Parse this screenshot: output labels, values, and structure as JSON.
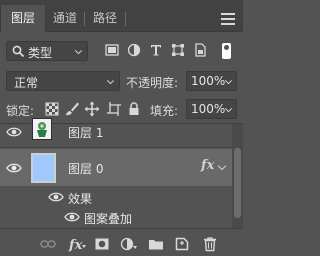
{
  "tabs": [
    {
      "label": "图层",
      "active": true
    },
    {
      "label": "通道",
      "active": false
    },
    {
      "label": "路径",
      "active": false
    }
  ],
  "filter": {
    "kind_label": "类型",
    "icons": [
      "image-filter-icon",
      "adjustment-filter-icon",
      "type-filter-icon",
      "shape-filter-icon",
      "smart-object-filter-icon"
    ]
  },
  "blend": {
    "mode": "正常",
    "opacity_label": "不透明度:",
    "opacity_value": "100%"
  },
  "lock": {
    "label": "锁定:",
    "fill_label": "填充:",
    "fill_value": "100%"
  },
  "layers": [
    {
      "name": "图层 1",
      "visible": true,
      "has_fx": false
    },
    {
      "name": "图层 0",
      "visible": true,
      "has_fx": true,
      "selected": true,
      "fx_label": "fx"
    }
  ],
  "effects": {
    "header": "效果",
    "items": [
      "图案叠加"
    ]
  },
  "colors": {
    "panel_bg": "#535353",
    "tab_bg": "#424242",
    "selected_row": "#696969",
    "layer0_thumb": "#a0c8ff"
  }
}
